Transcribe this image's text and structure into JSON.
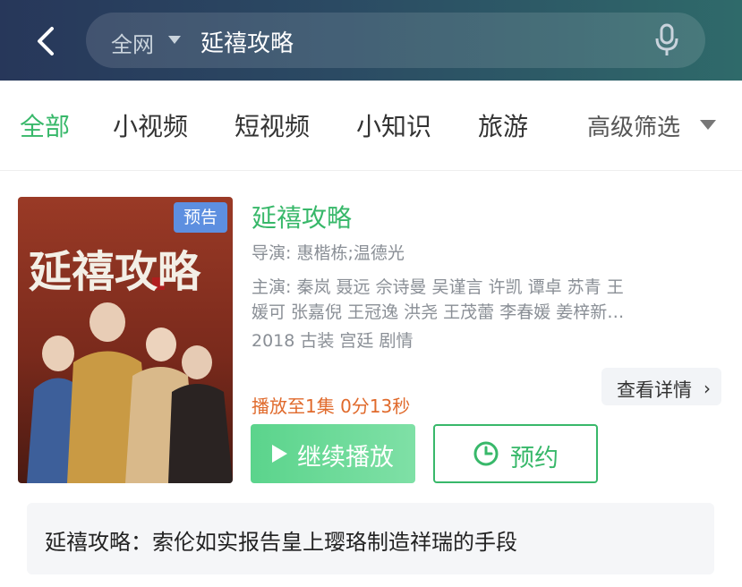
{
  "search": {
    "scope": "全网",
    "query": "延禧攻略"
  },
  "tabs": [
    {
      "label": "全部"
    },
    {
      "label": "小视频"
    },
    {
      "label": "短视频"
    },
    {
      "label": "小知识"
    },
    {
      "label": "旅游"
    }
  ],
  "filter": {
    "label": "高级筛选"
  },
  "result": {
    "badge": "预告",
    "title": "延禧攻略",
    "poster_title": "延禧攻略",
    "director": "导演: 惠楷栋;温德光",
    "cast_line1": "主演: 秦岚  聂远  佘诗曼  吴谨言  许凯  谭卓  苏青  王",
    "cast_line2": "媛可  张嘉倪  王冠逸  洪尧  王茂蕾  李春媛  姜梓新…",
    "tags": "2018  古装 宫廷 剧情",
    "details_label": "查看详情",
    "progress": "播放至1集 0分13秒",
    "play_label": "继续播放",
    "reserve_label": "预约"
  },
  "episode": {
    "text": "延禧攻略：索伦如实报告皇上璎珞制造祥瑞的手段"
  },
  "colors": {
    "accent": "#38b86a",
    "progress": "#e06a2c",
    "badge": "#5d8fe0"
  }
}
